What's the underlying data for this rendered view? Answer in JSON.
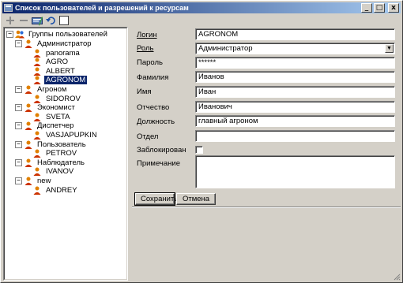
{
  "window": {
    "title": "Список пользователей и разрешений к ресурсам",
    "minimize_label": "_",
    "maximize_label": "□",
    "close_label": "x"
  },
  "toolbar": {
    "icons": [
      "plus-icon",
      "minus-icon",
      "edit-icon",
      "undo-icon",
      "help-icon"
    ],
    "help_label": "?"
  },
  "tree": {
    "root": "Группы пользователей",
    "nodes": [
      {
        "label": "Администратор",
        "level": 1,
        "expanded": true
      },
      {
        "label": "panorama",
        "level": 2
      },
      {
        "label": "AGRO",
        "level": 2
      },
      {
        "label": "ALBERT",
        "level": 2
      },
      {
        "label": "AGRONOM",
        "level": 2,
        "selected": true
      },
      {
        "label": "Агроном",
        "level": 1,
        "expanded": true
      },
      {
        "label": "SIDOROV",
        "level": 2
      },
      {
        "label": "Экономист",
        "level": 1,
        "expanded": true
      },
      {
        "label": "SVETA",
        "level": 2
      },
      {
        "label": "Диспетчер",
        "level": 1,
        "expanded": true
      },
      {
        "label": "VASJAPUPKIN",
        "level": 2
      },
      {
        "label": "Пользователь",
        "level": 1,
        "expanded": true
      },
      {
        "label": "PETROV",
        "level": 2
      },
      {
        "label": "Наблюдатель",
        "level": 1,
        "expanded": true
      },
      {
        "label": "IVANOV",
        "level": 2
      },
      {
        "label": "new",
        "level": 1,
        "expanded": true
      },
      {
        "label": "ANDREY",
        "level": 2
      }
    ],
    "expander_symbol": "−"
  },
  "form": {
    "login": {
      "label": "Логин",
      "value": "AGRONOM"
    },
    "role": {
      "label": "Роль",
      "value": "Администратор",
      "arrow": "▼"
    },
    "password": {
      "label": "Пароль",
      "value": "******"
    },
    "last_name": {
      "label": "Фамилия",
      "value": "Иванов"
    },
    "first_name": {
      "label": "Имя",
      "value": "Иван"
    },
    "patronymic": {
      "label": "Отчество",
      "value": "Иванович"
    },
    "position": {
      "label": "Должность",
      "value": "главный агроном"
    },
    "department": {
      "label": "Отдел",
      "value": ""
    },
    "blocked": {
      "label": "Заблокирован",
      "checked": false
    },
    "note": {
      "label": "Примечание",
      "value": ""
    },
    "save_label": "Сохранить",
    "cancel_label": "Отмена"
  },
  "colors": {
    "group_icon": "#cc3300",
    "user_icon": "#e08000",
    "selection": "#0a246a",
    "titlebar": "#0a246a"
  }
}
